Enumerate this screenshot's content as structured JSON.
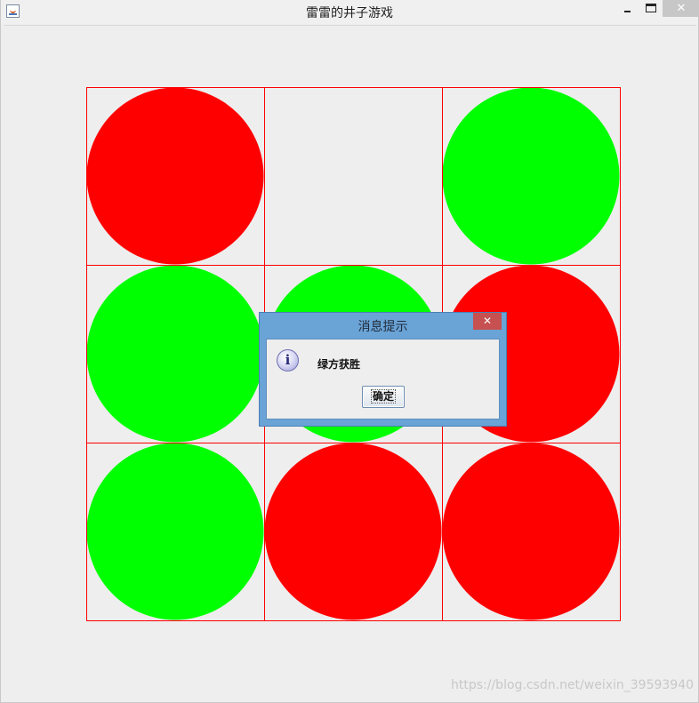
{
  "window": {
    "title": "雷雷的井子游戏",
    "minimize_icon": "minimize-icon",
    "maximize_icon": "maximize-icon",
    "close_glyph": "✕"
  },
  "board": {
    "grid_color": "#ff0000",
    "colors": {
      "red": "#ff0000",
      "green": "#00ff00"
    },
    "cells": [
      [
        "red",
        "",
        "green"
      ],
      [
        "green",
        "green",
        "red"
      ],
      [
        "green",
        "red",
        "red"
      ]
    ]
  },
  "dialog": {
    "title": "消息提示",
    "close_glyph": "✕",
    "icon": "info-icon",
    "icon_glyph": "i",
    "message": "绿方获胜",
    "ok_label": "确定"
  },
  "watermark": "https://blog.csdn.net/weixin_39593940"
}
